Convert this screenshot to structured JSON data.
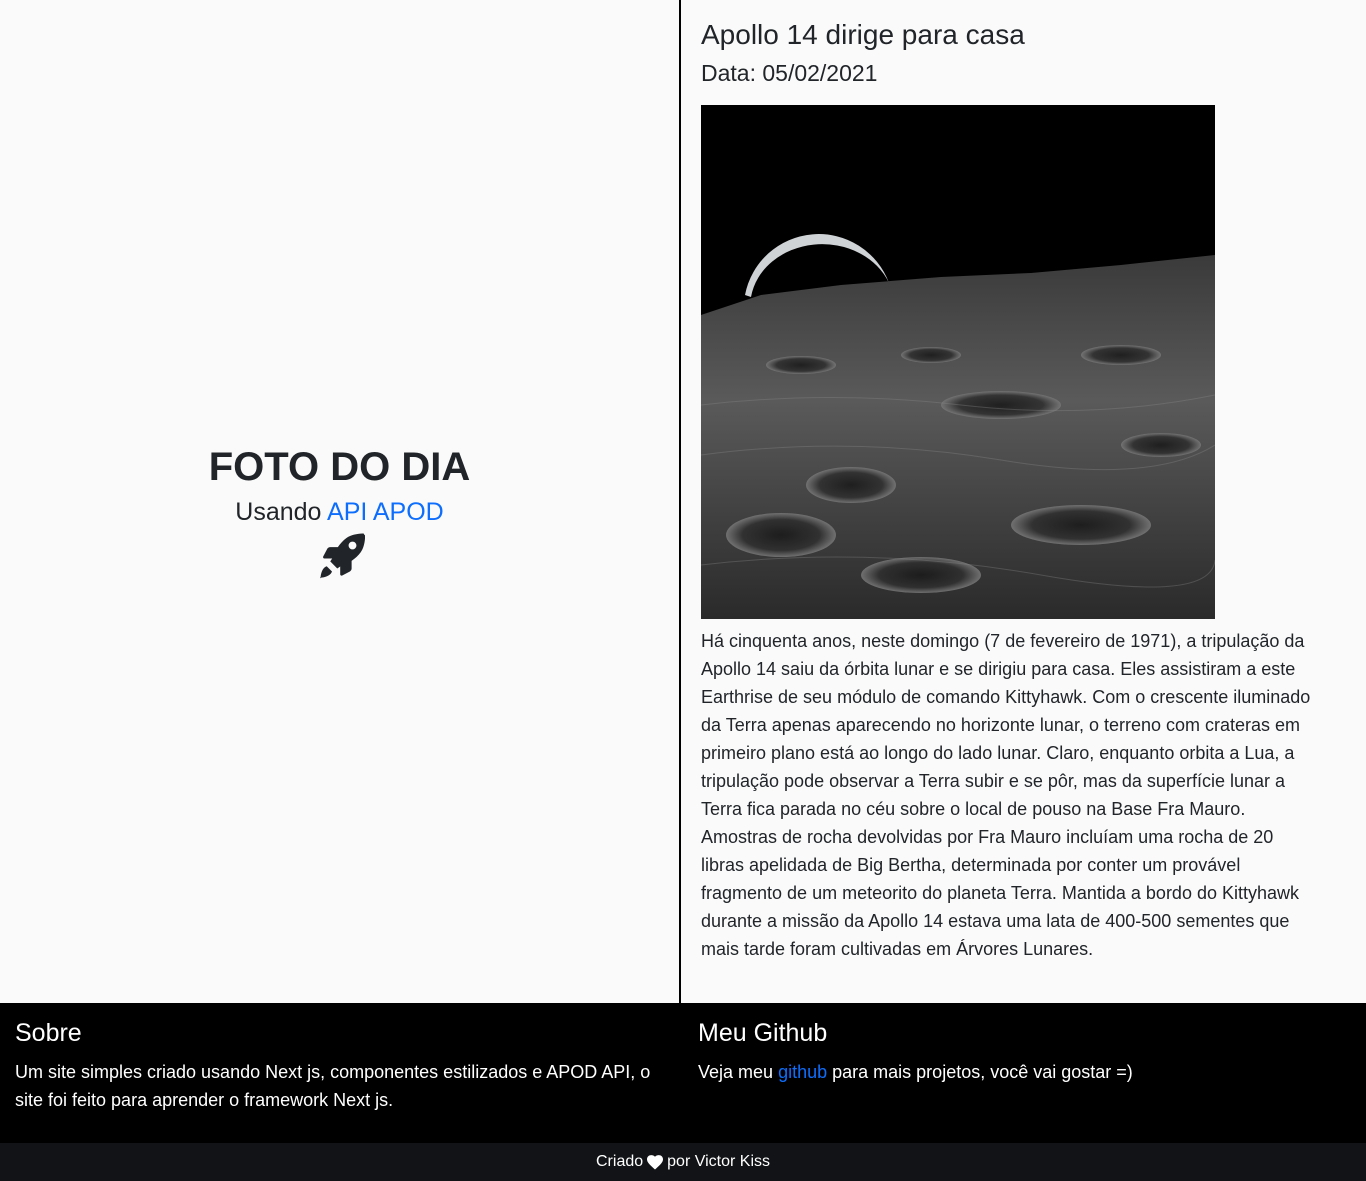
{
  "hero": {
    "title": "FOTO DO DIA",
    "subtitle_prefix": "Usando",
    "subtitle_link": "API APOD",
    "icon": "rocket-icon"
  },
  "apod": {
    "title": "Apollo 14 dirige para casa",
    "date": "Data: 05/02/2021",
    "image_description": "Earthrise crescent over lunar horizon",
    "explanation": "Há cinquenta anos, neste domingo (7 de fevereiro de 1971), a tripulação da Apollo 14 saiu da órbita lunar e se dirigiu para casa. Eles assistiram a este Earthrise de seu módulo de comando Kittyhawk. Com o crescente iluminado da Terra apenas aparecendo no horizonte lunar, o terreno com crateras em primeiro plano está ao longo do lado lunar. Claro, enquanto orbita a Lua, a tripulação pode observar a Terra subir e se pôr, mas da superfície lunar a Terra fica parada no céu sobre o local de pouso na Base Fra Mauro. Amostras de rocha devolvidas por Fra Mauro incluíam uma rocha de 20 libras apelidada de Big Bertha, determinada por conter um provável fragmento de um meteorito do planeta Terra. Mantida a bordo do Kittyhawk durante a missão da Apollo 14 estava uma lata de 400-500 sementes que mais tarde foram cultivadas em Árvores Lunares."
  },
  "footer": {
    "about_title": "Sobre",
    "about_text": "Um site simples criado usando Next js, componentes estilizados e APOD API, o site foi feito para aprender o framework Next js.",
    "github_title": "Meu Github",
    "github_prefix": "Veja meu",
    "github_link": "github",
    "github_suffix": "para mais projetos, você vai gostar =)"
  },
  "credits": {
    "prefix": "Criado",
    "suffix": "por Victor Kiss",
    "icon": "heart-icon"
  },
  "colors": {
    "link": "#0d6efd",
    "footer_bg": "#000000",
    "credits_bg": "#111316"
  }
}
